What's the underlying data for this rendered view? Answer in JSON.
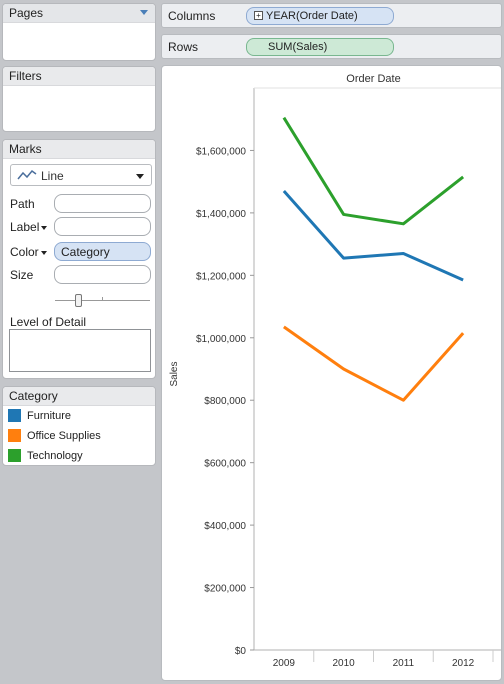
{
  "pages": {
    "title": "Pages"
  },
  "filters": {
    "title": "Filters"
  },
  "marks": {
    "title": "Marks",
    "mark_type": "Line",
    "mark_icon": "line-chart-icon",
    "properties": {
      "path": {
        "label": "Path",
        "value": ""
      },
      "label": {
        "label": "Label",
        "value": ""
      },
      "color": {
        "label": "Color",
        "value": "Category"
      },
      "size": {
        "label": "Size",
        "value": ""
      }
    },
    "size_level": 0.25,
    "level_of_detail": "Level of Detail"
  },
  "legend": {
    "title": "Category",
    "items": [
      {
        "label": "Furniture",
        "color": "#1f77b4"
      },
      {
        "label": "Office Supplies",
        "color": "#ff7f0e"
      },
      {
        "label": "Technology",
        "color": "#2ca02c"
      }
    ]
  },
  "shelves": {
    "columns": {
      "label": "Columns",
      "pill": "YEAR(Order Date)"
    },
    "rows": {
      "label": "Rows",
      "pill": "SUM(Sales)"
    }
  },
  "chart_data": {
    "type": "line",
    "title": "Order Date",
    "xlabel": "",
    "ylabel": "Sales",
    "categories": [
      "2009",
      "2010",
      "2011",
      "2012"
    ],
    "series": [
      {
        "name": "Furniture",
        "color": "#1f77b4",
        "values": [
          1470000,
          1255000,
          1270000,
          1185000
        ]
      },
      {
        "name": "Office Supplies",
        "color": "#ff7f0e",
        "values": [
          1035000,
          900000,
          800000,
          1015000
        ]
      },
      {
        "name": "Technology",
        "color": "#2ca02c",
        "values": [
          1705000,
          1395000,
          1365000,
          1515000
        ]
      }
    ],
    "yticks": [
      "$0",
      "$200,000",
      "$400,000",
      "$600,000",
      "$800,000",
      "$1,000,000",
      "$1,200,000",
      "$1,400,000",
      "$1,600,000"
    ],
    "ylim": [
      0,
      1800000
    ],
    "grid": false
  }
}
